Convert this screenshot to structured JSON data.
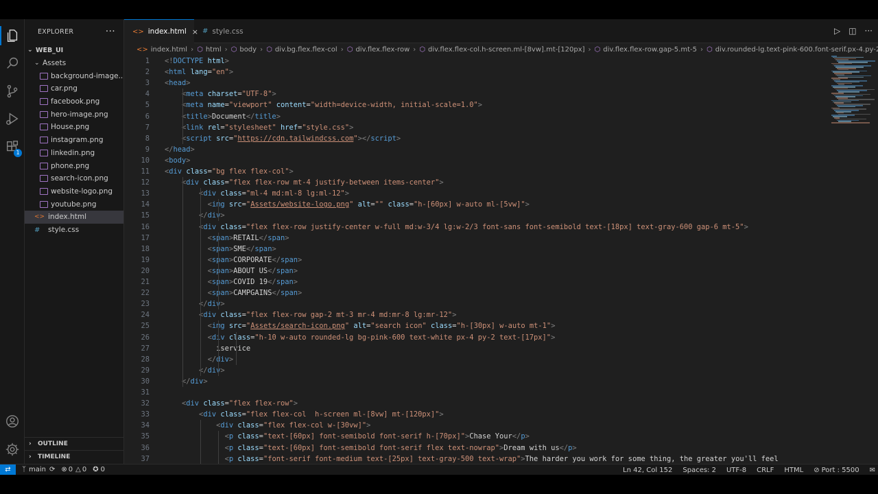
{
  "explorer": {
    "title": "EXPLORER",
    "more": "···",
    "root": "WEB_UI",
    "folder": "Assets",
    "assets": [
      "background-image....",
      "car.png",
      "facebook.png",
      "hero-image.png",
      "House.png",
      "instagram.png",
      "linkedin.png",
      "phone.png",
      "search-icon.png",
      "website-logo.png",
      "youtube.png"
    ],
    "root_files": [
      "index.html",
      "style.css"
    ],
    "outline": "OUTLINE",
    "timeline": "TIMELINE"
  },
  "activity": {
    "extensions_badge": "1"
  },
  "tabs": [
    {
      "label": "index.html",
      "icon": "<>",
      "active": true
    },
    {
      "label": "style.css",
      "icon": "#",
      "active": false
    }
  ],
  "tab_close": "×",
  "breadcrumbs": [
    {
      "icon": "<>",
      "label": "index.html"
    },
    {
      "icon": "⬡",
      "label": "html"
    },
    {
      "icon": "⬡",
      "label": "body"
    },
    {
      "icon": "⬡",
      "label": "div.bg.flex.flex-col"
    },
    {
      "icon": "⬡",
      "label": "div.flex.flex-row"
    },
    {
      "icon": "⬡",
      "label": "div.flex.flex-col.h-screen.ml-[8vw].mt-[120px]"
    },
    {
      "icon": "⬡",
      "label": "div.flex.flex-row.gap-5.mt-5"
    },
    {
      "icon": "⬡",
      "label": "div.rounded-lg.text-pink-600.font-serif.px-4.py-2.bo"
    }
  ],
  "code_lines": [
    [
      "1",
      [
        [
          "t",
          "<!"
        ],
        [
          "tn",
          "DOCTYPE"
        ],
        [
          "tx",
          " "
        ],
        [
          "an",
          "html"
        ],
        [
          "t",
          ">"
        ]
      ]
    ],
    [
      "2",
      [
        [
          "t",
          "<"
        ],
        [
          "tn",
          "html"
        ],
        [
          "tx",
          " "
        ],
        [
          "an",
          "lang"
        ],
        [
          "tx",
          "="
        ],
        [
          "av",
          "\"en\""
        ],
        [
          "t",
          ">"
        ]
      ]
    ],
    [
      "3",
      [
        [
          "t",
          "<"
        ],
        [
          "tn",
          "head"
        ],
        [
          "t",
          ">"
        ]
      ]
    ],
    [
      "4",
      [
        [
          "tx",
          "    "
        ],
        [
          "t",
          "<"
        ],
        [
          "tn",
          "meta"
        ],
        [
          "tx",
          " "
        ],
        [
          "an",
          "charset"
        ],
        [
          "tx",
          "="
        ],
        [
          "av",
          "\"UTF-8\""
        ],
        [
          "t",
          ">"
        ]
      ]
    ],
    [
      "5",
      [
        [
          "tx",
          "    "
        ],
        [
          "t",
          "<"
        ],
        [
          "tn",
          "meta"
        ],
        [
          "tx",
          " "
        ],
        [
          "an",
          "name"
        ],
        [
          "tx",
          "="
        ],
        [
          "av",
          "\"viewport\""
        ],
        [
          "tx",
          " "
        ],
        [
          "an",
          "content"
        ],
        [
          "tx",
          "="
        ],
        [
          "av",
          "\"width=device-width, initial-scale=1.0\""
        ],
        [
          "t",
          ">"
        ]
      ]
    ],
    [
      "6",
      [
        [
          "tx",
          "    "
        ],
        [
          "t",
          "<"
        ],
        [
          "tn",
          "title"
        ],
        [
          "t",
          ">"
        ],
        [
          "tx",
          "Document"
        ],
        [
          "t",
          "</"
        ],
        [
          "tn",
          "title"
        ],
        [
          "t",
          ">"
        ]
      ]
    ],
    [
      "7",
      [
        [
          "tx",
          "    "
        ],
        [
          "t",
          "<"
        ],
        [
          "tn",
          "link"
        ],
        [
          "tx",
          " "
        ],
        [
          "an",
          "rel"
        ],
        [
          "tx",
          "="
        ],
        [
          "av",
          "\"stylesheet\""
        ],
        [
          "tx",
          " "
        ],
        [
          "an",
          "href"
        ],
        [
          "tx",
          "="
        ],
        [
          "av",
          "\"style.css\""
        ],
        [
          "t",
          ">"
        ]
      ]
    ],
    [
      "8",
      [
        [
          "tx",
          "    "
        ],
        [
          "t",
          "<"
        ],
        [
          "tn",
          "script"
        ],
        [
          "tx",
          " "
        ],
        [
          "an",
          "src"
        ],
        [
          "tx",
          "="
        ],
        [
          "av",
          "\""
        ],
        [
          "avu",
          "https://cdn.tailwindcss.com"
        ],
        [
          "av",
          "\""
        ],
        [
          "t",
          ">"
        ],
        [
          "t",
          "</"
        ],
        [
          "tn",
          "script"
        ],
        [
          "t",
          ">"
        ]
      ]
    ],
    [
      "9",
      [
        [
          "t",
          "</"
        ],
        [
          "tn",
          "head"
        ],
        [
          "t",
          ">"
        ]
      ]
    ],
    [
      "10",
      [
        [
          "t",
          "<"
        ],
        [
          "tn",
          "body"
        ],
        [
          "t",
          ">"
        ]
      ]
    ],
    [
      "11",
      [
        [
          "t",
          "<"
        ],
        [
          "tn",
          "div"
        ],
        [
          "tx",
          " "
        ],
        [
          "an",
          "class"
        ],
        [
          "tx",
          "="
        ],
        [
          "av",
          "\"bg flex flex-col\""
        ],
        [
          "t",
          ">"
        ]
      ]
    ],
    [
      "12",
      [
        [
          "tx",
          "    "
        ],
        [
          "t",
          "<"
        ],
        [
          "tn",
          "div"
        ],
        [
          "tx",
          " "
        ],
        [
          "an",
          "class"
        ],
        [
          "tx",
          "="
        ],
        [
          "av",
          "\"flex flex-row mt-4 justify-between items-center\""
        ],
        [
          "t",
          ">"
        ]
      ]
    ],
    [
      "13",
      [
        [
          "tx",
          "        "
        ],
        [
          "t",
          "<"
        ],
        [
          "tn",
          "div"
        ],
        [
          "tx",
          " "
        ],
        [
          "an",
          "class"
        ],
        [
          "tx",
          "="
        ],
        [
          "av",
          "\"ml-4 md:ml-8 lg:ml-12\""
        ],
        [
          "t",
          ">"
        ]
      ]
    ],
    [
      "14",
      [
        [
          "tx",
          "          "
        ],
        [
          "t",
          "<"
        ],
        [
          "tn",
          "img"
        ],
        [
          "tx",
          " "
        ],
        [
          "an",
          "src"
        ],
        [
          "tx",
          "="
        ],
        [
          "av",
          "\""
        ],
        [
          "avu",
          "Assets/website-logo.png"
        ],
        [
          "av",
          "\""
        ],
        [
          "tx",
          " "
        ],
        [
          "an",
          "alt"
        ],
        [
          "tx",
          "="
        ],
        [
          "av",
          "\"\""
        ],
        [
          "tx",
          " "
        ],
        [
          "an",
          "class"
        ],
        [
          "tx",
          "="
        ],
        [
          "av",
          "\"h-[60px] w-auto ml-[5vw]\""
        ],
        [
          "t",
          ">"
        ]
      ]
    ],
    [
      "15",
      [
        [
          "tx",
          "        "
        ],
        [
          "t",
          "</"
        ],
        [
          "tn",
          "div"
        ],
        [
          "t",
          ">"
        ]
      ]
    ],
    [
      "16",
      [
        [
          "tx",
          "        "
        ],
        [
          "t",
          "<"
        ],
        [
          "tn",
          "div"
        ],
        [
          "tx",
          " "
        ],
        [
          "an",
          "class"
        ],
        [
          "tx",
          "="
        ],
        [
          "av",
          "\"flex flex-row justify-center w-full md:w-3/4 lg:w-2/3 font-sans font-semibold text-[18px] text-gray-600 gap-6 mt-5\""
        ],
        [
          "t",
          ">"
        ]
      ]
    ],
    [
      "17",
      [
        [
          "tx",
          "          "
        ],
        [
          "t",
          "<"
        ],
        [
          "tn",
          "span"
        ],
        [
          "t",
          ">"
        ],
        [
          "tx",
          "RETAIL"
        ],
        [
          "t",
          "</"
        ],
        [
          "tn",
          "span"
        ],
        [
          "t",
          ">"
        ]
      ]
    ],
    [
      "18",
      [
        [
          "tx",
          "          "
        ],
        [
          "t",
          "<"
        ],
        [
          "tn",
          "span"
        ],
        [
          "t",
          ">"
        ],
        [
          "tx",
          "SME"
        ],
        [
          "t",
          "</"
        ],
        [
          "tn",
          "span"
        ],
        [
          "t",
          ">"
        ]
      ]
    ],
    [
      "19",
      [
        [
          "tx",
          "          "
        ],
        [
          "t",
          "<"
        ],
        [
          "tn",
          "span"
        ],
        [
          "t",
          ">"
        ],
        [
          "tx",
          "CORPORATE"
        ],
        [
          "t",
          "</"
        ],
        [
          "tn",
          "span"
        ],
        [
          "t",
          ">"
        ]
      ]
    ],
    [
      "20",
      [
        [
          "tx",
          "          "
        ],
        [
          "t",
          "<"
        ],
        [
          "tn",
          "span"
        ],
        [
          "t",
          ">"
        ],
        [
          "tx",
          "ABOUT US"
        ],
        [
          "t",
          "</"
        ],
        [
          "tn",
          "span"
        ],
        [
          "t",
          ">"
        ]
      ]
    ],
    [
      "21",
      [
        [
          "tx",
          "          "
        ],
        [
          "t",
          "<"
        ],
        [
          "tn",
          "span"
        ],
        [
          "t",
          ">"
        ],
        [
          "tx",
          "COVID 19"
        ],
        [
          "t",
          "</"
        ],
        [
          "tn",
          "span"
        ],
        [
          "t",
          ">"
        ]
      ]
    ],
    [
      "22",
      [
        [
          "tx",
          "          "
        ],
        [
          "t",
          "<"
        ],
        [
          "tn",
          "span"
        ],
        [
          "t",
          ">"
        ],
        [
          "tx",
          "CAMPGAINS"
        ],
        [
          "t",
          "</"
        ],
        [
          "tn",
          "span"
        ],
        [
          "t",
          ">"
        ]
      ]
    ],
    [
      "23",
      [
        [
          "tx",
          "        "
        ],
        [
          "t",
          "</"
        ],
        [
          "tn",
          "div"
        ],
        [
          "t",
          ">"
        ]
      ]
    ],
    [
      "24",
      [
        [
          "tx",
          "        "
        ],
        [
          "t",
          "<"
        ],
        [
          "tn",
          "div"
        ],
        [
          "tx",
          " "
        ],
        [
          "an",
          "class"
        ],
        [
          "tx",
          "="
        ],
        [
          "av",
          "\"flex flex-row gap-2 mt-3 mr-4 md:mr-8 lg:mr-12\""
        ],
        [
          "t",
          ">"
        ]
      ]
    ],
    [
      "25",
      [
        [
          "tx",
          "          "
        ],
        [
          "t",
          "<"
        ],
        [
          "tn",
          "img"
        ],
        [
          "tx",
          " "
        ],
        [
          "an",
          "src"
        ],
        [
          "tx",
          "="
        ],
        [
          "av",
          "\""
        ],
        [
          "avu",
          "Assets/search-icon.png"
        ],
        [
          "av",
          "\""
        ],
        [
          "tx",
          " "
        ],
        [
          "an",
          "alt"
        ],
        [
          "tx",
          "="
        ],
        [
          "av",
          "\"search icon\""
        ],
        [
          "tx",
          " "
        ],
        [
          "an",
          "class"
        ],
        [
          "tx",
          "="
        ],
        [
          "av",
          "\"h-[30px] w-auto mt-1\""
        ],
        [
          "t",
          ">"
        ]
      ]
    ],
    [
      "26",
      [
        [
          "tx",
          "          "
        ],
        [
          "t",
          "<"
        ],
        [
          "tn",
          "div"
        ],
        [
          "tx",
          " "
        ],
        [
          "an",
          "class"
        ],
        [
          "tx",
          "="
        ],
        [
          "av",
          "\"h-10 w-auto rounded-lg bg-pink-600 text-white px-4 py-2 text-[17px]\""
        ],
        [
          "t",
          ">"
        ]
      ]
    ],
    [
      "27",
      [
        [
          "tx",
          "            iservice"
        ]
      ]
    ],
    [
      "28",
      [
        [
          "tx",
          "          "
        ],
        [
          "t",
          "</"
        ],
        [
          "tn",
          "div"
        ],
        [
          "t",
          ">"
        ]
      ]
    ],
    [
      "29",
      [
        [
          "tx",
          "        "
        ],
        [
          "t",
          "</"
        ],
        [
          "tn",
          "div"
        ],
        [
          "t",
          ">"
        ]
      ]
    ],
    [
      "30",
      [
        [
          "tx",
          "    "
        ],
        [
          "t",
          "</"
        ],
        [
          "tn",
          "div"
        ],
        [
          "t",
          ">"
        ]
      ]
    ],
    [
      "31",
      []
    ],
    [
      "32",
      [
        [
          "tx",
          "    "
        ],
        [
          "t",
          "<"
        ],
        [
          "tn",
          "div"
        ],
        [
          "tx",
          " "
        ],
        [
          "an",
          "class"
        ],
        [
          "tx",
          "="
        ],
        [
          "av",
          "\"flex flex-row\""
        ],
        [
          "t",
          ">"
        ]
      ]
    ],
    [
      "33",
      [
        [
          "tx",
          "        "
        ],
        [
          "t",
          "<"
        ],
        [
          "tn",
          "div"
        ],
        [
          "tx",
          " "
        ],
        [
          "an",
          "class"
        ],
        [
          "tx",
          "="
        ],
        [
          "av",
          "\"flex flex-col  h-screen ml-[8vw] mt-[120px]\""
        ],
        [
          "t",
          ">"
        ]
      ]
    ],
    [
      "34",
      [
        [
          "tx",
          "            "
        ],
        [
          "t",
          "<"
        ],
        [
          "tn",
          "div"
        ],
        [
          "tx",
          " "
        ],
        [
          "an",
          "class"
        ],
        [
          "tx",
          "="
        ],
        [
          "av",
          "\"flex flex-col w-[30vw]\""
        ],
        [
          "t",
          ">"
        ]
      ]
    ],
    [
      "35",
      [
        [
          "tx",
          "              "
        ],
        [
          "t",
          "<"
        ],
        [
          "tn",
          "p"
        ],
        [
          "tx",
          " "
        ],
        [
          "an",
          "class"
        ],
        [
          "tx",
          "="
        ],
        [
          "av",
          "\"text-[60px] font-semibold font-serif h-[70px]\""
        ],
        [
          "t",
          ">"
        ],
        [
          "tx",
          "Chase Your"
        ],
        [
          "t",
          "</"
        ],
        [
          "tn",
          "p"
        ],
        [
          "t",
          ">"
        ]
      ]
    ],
    [
      "36",
      [
        [
          "tx",
          "              "
        ],
        [
          "t",
          "<"
        ],
        [
          "tn",
          "p"
        ],
        [
          "tx",
          " "
        ],
        [
          "an",
          "class"
        ],
        [
          "tx",
          "="
        ],
        [
          "av",
          "\"text-[60px] font-semibold font-serif flex text-nowrap\""
        ],
        [
          "t",
          ">"
        ],
        [
          "tx",
          "Dream with us"
        ],
        [
          "t",
          "</"
        ],
        [
          "tn",
          "p"
        ],
        [
          "t",
          ">"
        ]
      ]
    ],
    [
      "37",
      [
        [
          "tx",
          "              "
        ],
        [
          "t",
          "<"
        ],
        [
          "tn",
          "p"
        ],
        [
          "tx",
          " "
        ],
        [
          "an",
          "class"
        ],
        [
          "tx",
          "="
        ],
        [
          "av",
          "\"font-serif font-medium text-[25px] text-gray-500 text-wrap\""
        ],
        [
          "t",
          ">"
        ],
        [
          "tx",
          "The harder you work for some thing, the greater you'll feel"
        ]
      ]
    ]
  ],
  "status": {
    "branch": "main",
    "errors": "0",
    "warnings": "0",
    "ports": "0",
    "position": "Ln 42, Col 152",
    "spaces": "Spaces: 2",
    "encoding": "UTF-8",
    "eol": "CRLF",
    "language": "HTML",
    "port": "Port : 5500"
  },
  "colors": {
    "accent": "#0078d4",
    "tag": "#569cd6",
    "attr": "#9cdcfe",
    "string": "#ce9178"
  }
}
